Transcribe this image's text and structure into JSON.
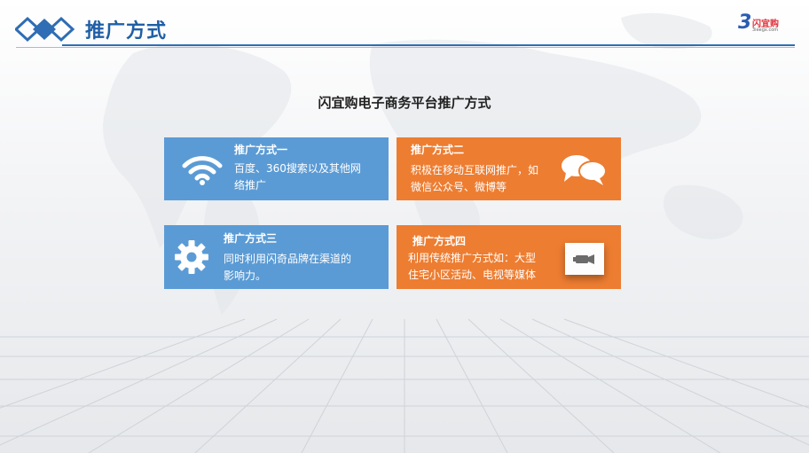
{
  "header": {
    "title": "推广方式",
    "brand_name": "闪宜购",
    "brand_url": "3ieegx.com"
  },
  "main": {
    "subtitle": "闪宜购电子商务平台推广方式",
    "cards": [
      {
        "title": "推广方式一",
        "desc_line1": "百度、360搜索以及其他网",
        "desc_line2": "络推广",
        "icon": "wifi-icon",
        "color": "#5b9bd5"
      },
      {
        "title": "推广方式二",
        "desc_line1": "积极在移动互联网推广，如",
        "desc_line2": "微信公众号、微博等",
        "icon": "chat-bubbles-icon",
        "color": "#ed7d31"
      },
      {
        "title": "推广方式三",
        "desc_line1": "同时利用闪奇品牌在渠道的",
        "desc_line2": "影响力。",
        "icon": "gear-icon",
        "color": "#5b9bd5"
      },
      {
        "title": "推广方式四",
        "desc_line1": "利用传统推广方式如：大型",
        "desc_line2": "住宅小区活动、电视等媒体",
        "icon": "video-camera-icon",
        "color": "#ed7d31"
      }
    ]
  }
}
